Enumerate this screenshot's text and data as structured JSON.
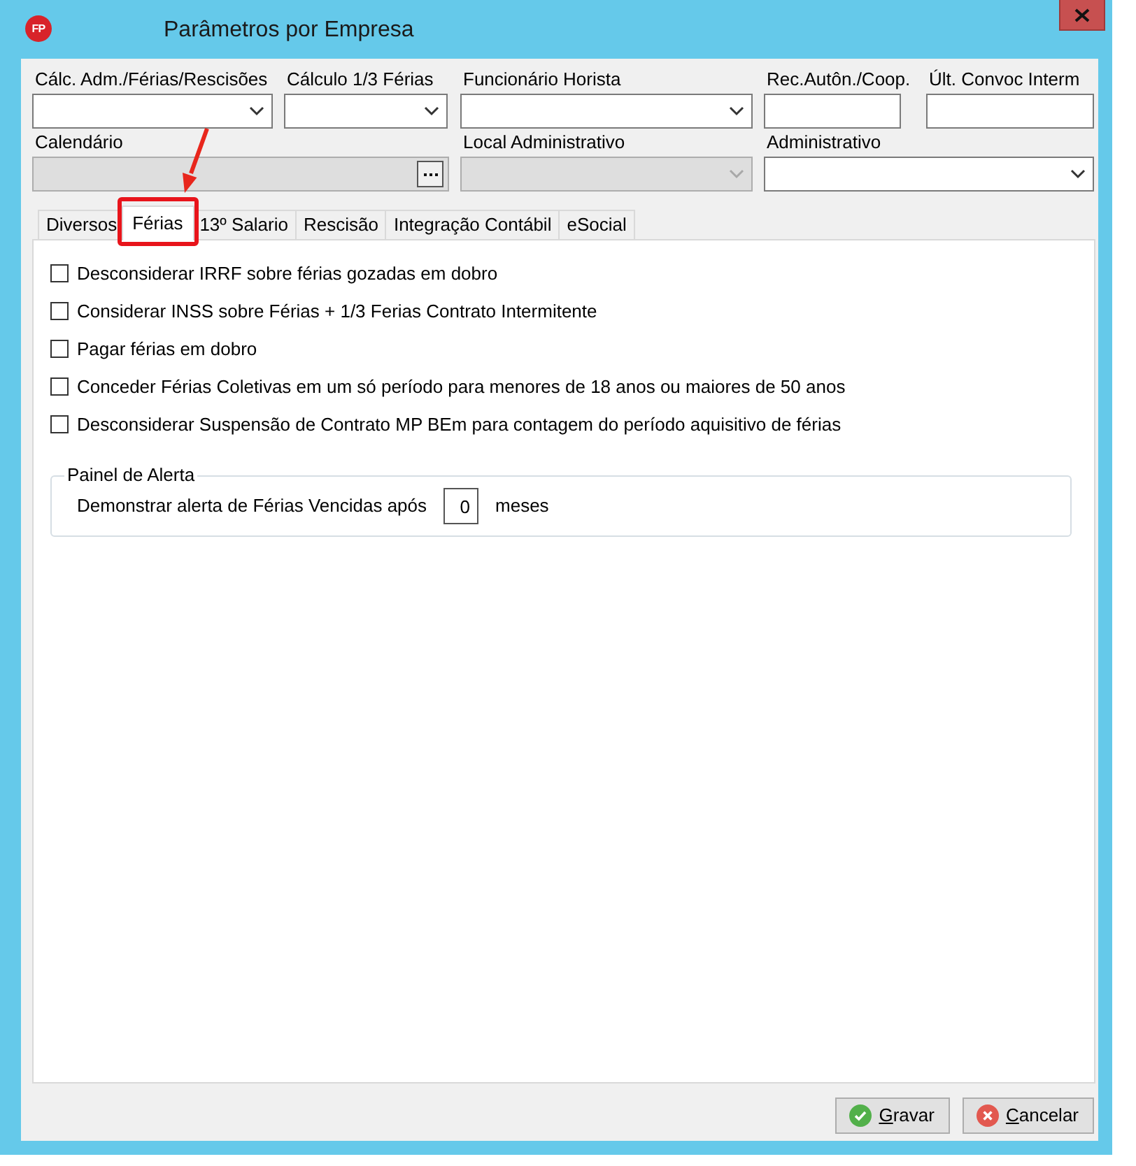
{
  "window": {
    "logo": "FP",
    "title": "Parâmetros por Empresa"
  },
  "field_rows": [
    [
      {
        "label": "Cálc. Adm./Férias/Rescisões",
        "kind": "dropdown",
        "disabled": false
      },
      {
        "label": "Cálculo 1/3 Férias",
        "kind": "dropdown",
        "disabled": false
      },
      {
        "label": "Funcionário Horista",
        "kind": "dropdown",
        "disabled": false
      },
      {
        "label": "Rec.Autôn./Coop.",
        "kind": "text",
        "disabled": false
      },
      {
        "label": "Últ. Convoc Interm",
        "kind": "text",
        "disabled": false
      }
    ],
    [
      {
        "label": "Calendário",
        "kind": "lookup",
        "disabled": true
      },
      {
        "label": "Local Administrativo",
        "kind": "dropdown",
        "disabled": true
      },
      {
        "label": "Administrativo",
        "kind": "dropdown",
        "disabled": false
      }
    ]
  ],
  "tabs": [
    {
      "label": "Diversos",
      "selected": false
    },
    {
      "label": "Férias",
      "selected": true
    },
    {
      "label": "13º Salario",
      "selected": false
    },
    {
      "label": "Rescisão",
      "selected": false
    },
    {
      "label": "Integração Contábil",
      "selected": false
    },
    {
      "label": "eSocial",
      "selected": false
    }
  ],
  "options": [
    {
      "label": "Desconsiderar IRRF sobre férias gozadas em dobro",
      "checked": false
    },
    {
      "label": "Considerar INSS sobre Férias + 1/3 Ferias Contrato Intermitente",
      "checked": false
    },
    {
      "label": "Pagar férias em dobro",
      "checked": false
    },
    {
      "label": "Conceder Férias Coletivas em um só período para menores de 18 anos ou maiores de 50 anos",
      "checked": false
    },
    {
      "label": "Desconsiderar Suspensão de Contrato MP BEm para contagem do período aquisitivo de férias",
      "checked": false
    }
  ],
  "alert_panel": {
    "title": "Painel de Alerta",
    "label": "Demonstrar alerta de Férias Vencidas após",
    "value": "0",
    "unit": "meses"
  },
  "buttons": [
    {
      "label": "Gravar",
      "kind": "save",
      "mnemonic": true
    },
    {
      "label": "Cancelar",
      "kind": "cancel",
      "mnemonic": true
    }
  ]
}
